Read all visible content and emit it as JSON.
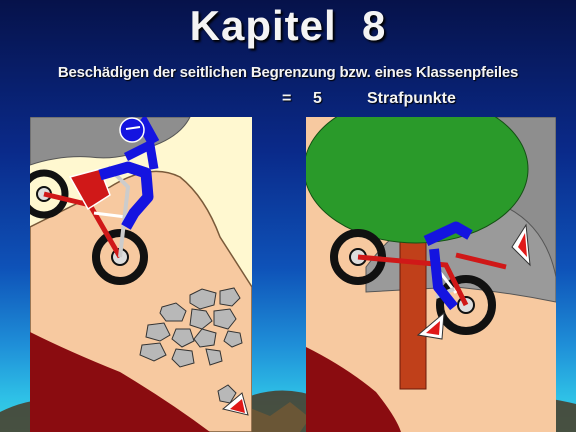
{
  "slide": {
    "title": "Kapitel  8",
    "subtitle": "Beschädigen der seitlichen Begrenzung bzw. eines Klassenpfeiles",
    "penalty": {
      "equals": "=",
      "points": "5",
      "label": "Strafpunkte"
    }
  },
  "colors": {
    "background_top": "#06124a",
    "background_bottom": "#38d4e0",
    "ground": "#f7c9a0",
    "rider": "#1414e0",
    "bike_frame": "#d01818",
    "tree_crown": "#2a9a2a",
    "tree_trunk": "#c0401a",
    "marker_red": "#e01818"
  },
  "icons": [
    "motorcycle-rider-icon",
    "rock-pile-icon",
    "tree-icon",
    "class-arrow-marker-icon"
  ]
}
